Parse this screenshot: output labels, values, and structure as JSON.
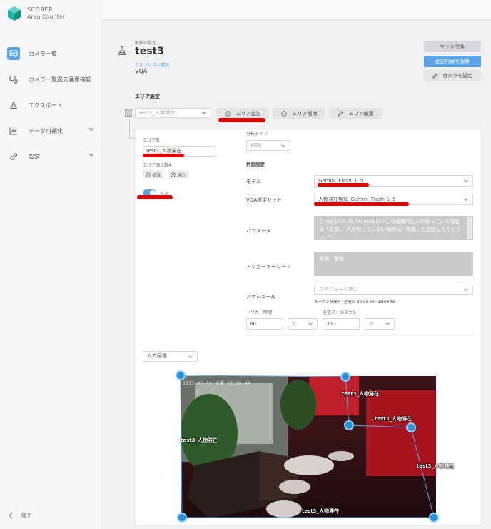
{
  "brand": {
    "line1": "SCORER",
    "line2": "Area Counter"
  },
  "nav": {
    "items": [
      {
        "label": "カメラ一覧",
        "icon": "camera-list-icon"
      },
      {
        "label": "カメラ一覧過去画像確認",
        "icon": "history-icon"
      },
      {
        "label": "エクスポート",
        "icon": "flask-icon"
      },
      {
        "label": "データ可視化",
        "icon": "chart-icon"
      },
      {
        "label": "設定",
        "icon": "gear-icon"
      }
    ],
    "hide_label": "隠す"
  },
  "header": {
    "small_label": "解析の設定",
    "title": "test3",
    "algo_label": "アルゴリズム種別",
    "algo_value": "VQA"
  },
  "actions": {
    "cancel": "キャンセル",
    "save": "変更内容を保存",
    "set_camera": "カメラを設定"
  },
  "area": {
    "heading": "エリア設定",
    "select_placeholder": "test3_人物滞在",
    "add": "エリア追加",
    "delete": "エリア削除",
    "edit": "エリア編集"
  },
  "area_form": {
    "name_label": "エリア名",
    "name_value": "test3_人物滞在",
    "vertex_label": "エリア頂点数4",
    "add_vertex": "追加",
    "reduce_vertex": "減少",
    "enabled_label": "有効"
  },
  "analysis": {
    "type_label": "分析タイプ",
    "type_value": "VQA",
    "judge_heading": "判定設定",
    "model_label": "モデル",
    "model_value": "Gemini_Flash_1_5",
    "vqa_set_label": "VQA設定セット",
    "vqa_set_value": "人物滞在検知_Gemini_Flash_1_5",
    "param_label": "パラメータ",
    "param_value": "{\"top_p\":0.95,\"question\":\"この画像内に人が映っている場合は「正常」、人が映っていない場合は「発報」と回答してください。\"}",
    "trigger_label": "トリガーキーワード",
    "trigger_value": "発報、警報",
    "schedule_label": "スケジュール",
    "schedule_placeholder": "スケジュール無し",
    "open_hours": "オープン時間外: 全曜日 00:00:00~18:00:59",
    "trigger_time_label": "トリガー時間",
    "trigger_time_value": "60",
    "trigger_time_unit": "秒",
    "cooldown_label": "送信クールダウン",
    "cooldown_value": "360",
    "cooldown_unit": "秒"
  },
  "image": {
    "source_select": "入力画像",
    "timestamp": "2025-02-19 水曜 01:38:44",
    "region_labels": [
      "test3_人物滞在",
      "test3_人物滞在",
      "test3_人物滞在",
      "test3_人物滞在",
      "test3_人物滞在"
    ]
  },
  "colors": {
    "accent": "#5aa3e6",
    "annotation": "#e00000",
    "region_line": "#5aa3e6"
  }
}
